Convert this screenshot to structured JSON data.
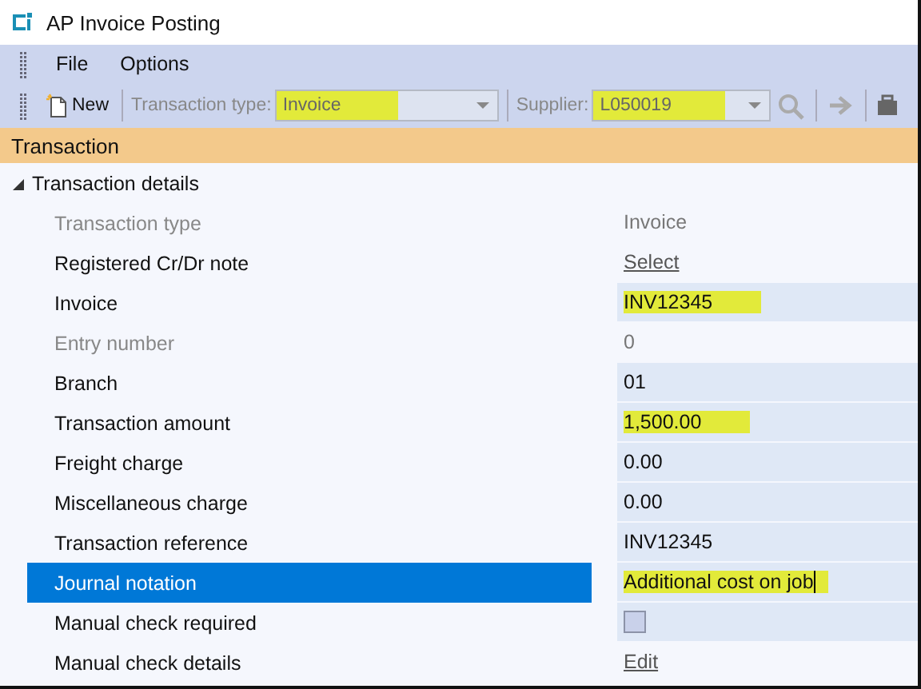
{
  "window": {
    "title": "AP Invoice Posting"
  },
  "menu": [
    "File",
    "Options"
  ],
  "toolbar": {
    "new_label": "New",
    "transaction_type": {
      "label": "Transaction type:",
      "value": "Invoice",
      "disabled": true,
      "highlighted": true
    },
    "supplier": {
      "label": "Supplier:",
      "value": "L050019",
      "disabled": true,
      "highlighted": true
    }
  },
  "section": {
    "title": "Transaction"
  },
  "group": {
    "title": "Transaction details",
    "expanded": true,
    "rows": [
      {
        "label": "Transaction type",
        "kind": "text",
        "value": "Invoice",
        "disabled": true,
        "selected": false
      },
      {
        "label": "Registered Cr/Dr note",
        "kind": "link",
        "value": "Select",
        "disabled": false,
        "selected": false
      },
      {
        "label": "Invoice",
        "kind": "field",
        "value": "INV12345",
        "disabled": false,
        "selected": false,
        "highlighted": true
      },
      {
        "label": "Entry number",
        "kind": "text",
        "value": "0",
        "disabled": true,
        "selected": false
      },
      {
        "label": "Branch",
        "kind": "field",
        "value": "01",
        "disabled": false,
        "selected": false
      },
      {
        "label": "Transaction amount",
        "kind": "field",
        "value": "1,500.00",
        "disabled": false,
        "selected": false,
        "highlighted": true
      },
      {
        "label": "Freight charge",
        "kind": "field",
        "value": "0.00",
        "disabled": false,
        "selected": false
      },
      {
        "label": "Miscellaneous charge",
        "kind": "field",
        "value": "0.00",
        "disabled": false,
        "selected": false
      },
      {
        "label": "Transaction reference",
        "kind": "field",
        "value": "INV12345",
        "disabled": false,
        "selected": false
      },
      {
        "label": "Journal notation",
        "kind": "field",
        "value": "Additional cost on job",
        "disabled": false,
        "selected": true,
        "highlighted": true
      },
      {
        "label": "Manual check required",
        "kind": "checkbox",
        "checked": false,
        "disabled": false,
        "selected": false
      },
      {
        "label": "Manual check details",
        "kind": "link",
        "value": "Edit",
        "disabled": false,
        "selected": false
      }
    ]
  }
}
